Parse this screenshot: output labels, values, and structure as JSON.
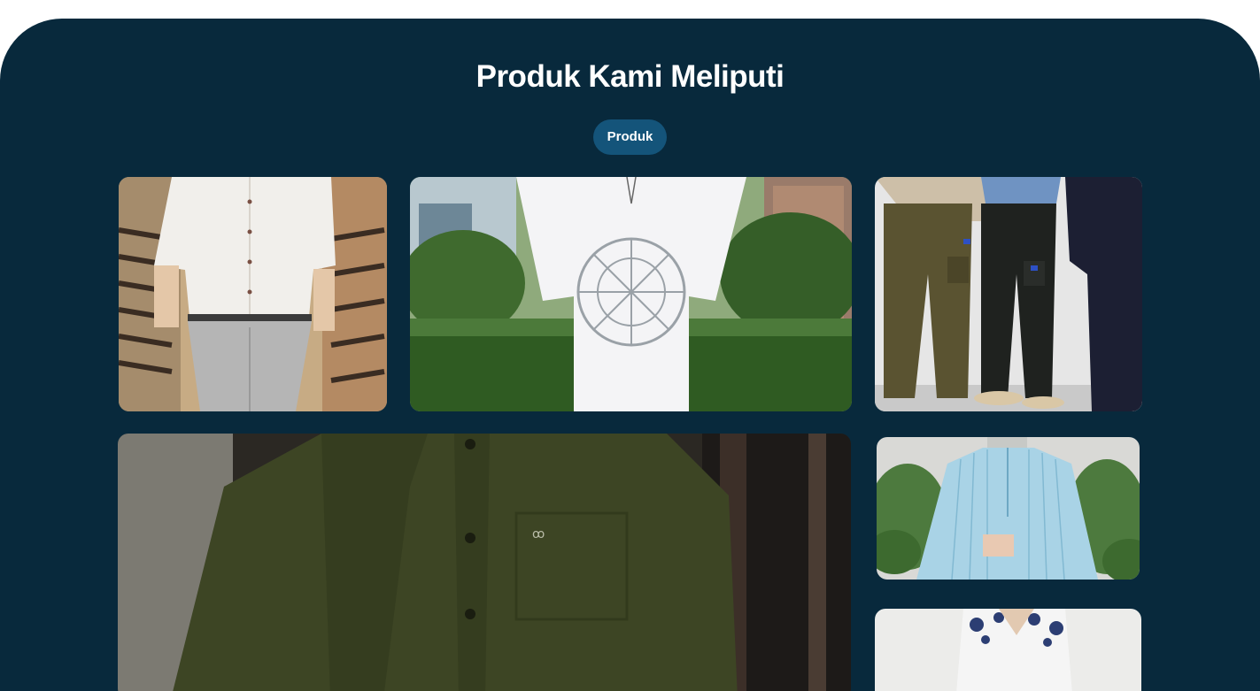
{
  "section": {
    "title": "Produk Kami Meliputi",
    "badge_label": "Produk"
  },
  "gallery": {
    "items": [
      {
        "subject": "white-shirt-photo"
      },
      {
        "subject": "white-graphic-tshirt-photo"
      },
      {
        "subject": "cargo-pants-photo"
      },
      {
        "subject": "olive-polo-shirt-photo"
      },
      {
        "subject": "striped-blouse-photo"
      },
      {
        "subject": "patterned-shirt-photo"
      }
    ]
  },
  "colors": {
    "background": "#08293c",
    "badge": "#14547a",
    "text": "#ffffff"
  }
}
